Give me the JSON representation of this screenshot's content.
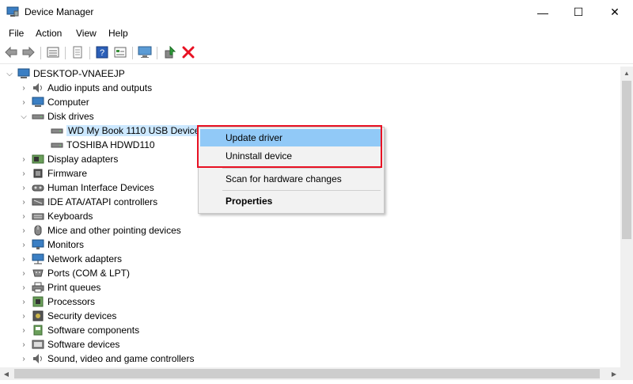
{
  "window": {
    "title": "Device Manager",
    "minimize_glyph": "—",
    "maximize_glyph": "☐",
    "close_glyph": "✕"
  },
  "menu": [
    "File",
    "Action",
    "View",
    "Help"
  ],
  "toolbar": {
    "icons": [
      "back-arrow-icon",
      "forward-arrow-icon",
      "properties-view-icon",
      "print-icon",
      "help-icon",
      "show-hidden-icon",
      "monitor-scan-icon",
      "update-driver-icon",
      "uninstall-icon"
    ],
    "uninstall_color": "#e81123"
  },
  "tree": {
    "root": "DESKTOP-VNAEEJP",
    "categories": [
      {
        "label": "Audio inputs and outputs",
        "icon": "speaker-icon"
      },
      {
        "label": "Computer",
        "icon": "computer-icon"
      },
      {
        "label": "Disk drives",
        "icon": "disk-drive-icon",
        "expanded": true,
        "children": [
          {
            "label": "WD My Book 1110 USB Device",
            "selected": true
          },
          {
            "label": "TOSHIBA HDWD110"
          }
        ]
      },
      {
        "label": "Display adapters",
        "icon": "display-adapter-icon"
      },
      {
        "label": "Firmware",
        "icon": "firmware-icon"
      },
      {
        "label": "Human Interface Devices",
        "icon": "hid-icon"
      },
      {
        "label": "IDE ATA/ATAPI controllers",
        "icon": "ide-controller-icon"
      },
      {
        "label": "Keyboards",
        "icon": "keyboard-icon"
      },
      {
        "label": "Mice and other pointing devices",
        "icon": "mouse-icon"
      },
      {
        "label": "Monitors",
        "icon": "monitor-icon"
      },
      {
        "label": "Network adapters",
        "icon": "network-adapter-icon"
      },
      {
        "label": "Ports (COM & LPT)",
        "icon": "port-icon"
      },
      {
        "label": "Print queues",
        "icon": "printer-icon"
      },
      {
        "label": "Processors",
        "icon": "processor-icon"
      },
      {
        "label": "Security devices",
        "icon": "security-device-icon"
      },
      {
        "label": "Software components",
        "icon": "software-component-icon"
      },
      {
        "label": "Software devices",
        "icon": "software-device-icon"
      },
      {
        "label": "Sound, video and game controllers",
        "icon": "sound-controller-icon"
      }
    ]
  },
  "context_menu": {
    "update_driver": "Update driver",
    "uninstall_device": "Uninstall device",
    "scan": "Scan for hardware changes",
    "properties": "Properties",
    "highlight_color": "#e81123",
    "hover_color": "#91c9f7"
  }
}
